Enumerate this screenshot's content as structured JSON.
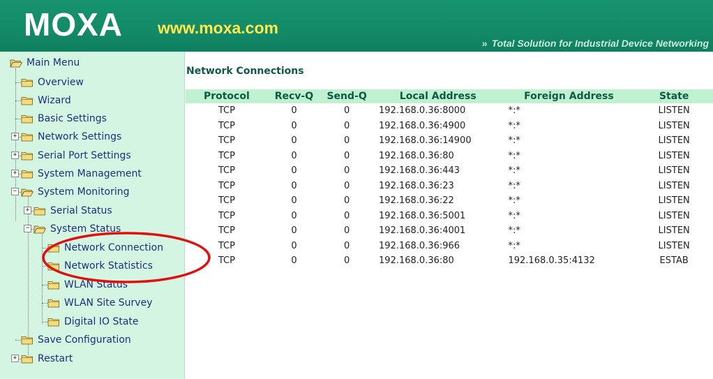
{
  "header": {
    "logo": "MOXA",
    "website": "www.moxa.com",
    "tagline": "Total Solution for Industrial Device Networking",
    "tagline_arrow": "»"
  },
  "sidebar": {
    "items": [
      {
        "label": "Main Menu",
        "expanded": true
      },
      {
        "label": "Overview"
      },
      {
        "label": "Wizard"
      },
      {
        "label": "Basic Settings"
      },
      {
        "label": "Network Settings",
        "expander": "+"
      },
      {
        "label": "Serial Port Settings",
        "expander": "+"
      },
      {
        "label": "System Management",
        "expander": "+"
      },
      {
        "label": "System Monitoring",
        "expander": "-",
        "expanded": true
      },
      {
        "label": "Serial Status",
        "expander": "+"
      },
      {
        "label": "System Status",
        "expander": "-",
        "expanded": true
      },
      {
        "label": "Network Connection",
        "selected": true
      },
      {
        "label": "Network Statistics"
      },
      {
        "label": "WLAN Status"
      },
      {
        "label": "WLAN Site Survey"
      },
      {
        "label": "Digital IO State"
      },
      {
        "label": "Save Configuration"
      },
      {
        "label": "Restart",
        "expander": "+"
      }
    ]
  },
  "main": {
    "title": "Network Connections",
    "columns": [
      "Protocol",
      "Recv-Q",
      "Send-Q",
      "Local Address",
      "Foreign Address",
      "State"
    ],
    "rows": [
      [
        "TCP",
        "0",
        "0",
        "192.168.0.36:8000",
        "*:*",
        "LISTEN"
      ],
      [
        "TCP",
        "0",
        "0",
        "192.168.0.36:4900",
        "*:*",
        "LISTEN"
      ],
      [
        "TCP",
        "0",
        "0",
        "192.168.0.36:14900",
        "*:*",
        "LISTEN"
      ],
      [
        "TCP",
        "0",
        "0",
        "192.168.0.36:80",
        "*:*",
        "LISTEN"
      ],
      [
        "TCP",
        "0",
        "0",
        "192.168.0.36:443",
        "*:*",
        "LISTEN"
      ],
      [
        "TCP",
        "0",
        "0",
        "192.168.0.36:23",
        "*:*",
        "LISTEN"
      ],
      [
        "TCP",
        "0",
        "0",
        "192.168.0.36:22",
        "*:*",
        "LISTEN"
      ],
      [
        "TCP",
        "0",
        "0",
        "192.168.0.36:5001",
        "*:*",
        "LISTEN"
      ],
      [
        "TCP",
        "0",
        "0",
        "192.168.0.36:4001",
        "*:*",
        "LISTEN"
      ],
      [
        "TCP",
        "0",
        "0",
        "192.168.0.36:966",
        "*:*",
        "LISTEN"
      ],
      [
        "TCP",
        "0",
        "0",
        "192.168.0.36:80",
        "192.168.0.35:4132",
        "ESTAB"
      ]
    ]
  },
  "colors": {
    "header_green": "#138a68",
    "sidebar_bg": "#d5f5e3",
    "table_header_bg": "#bff0cf",
    "annotation_red": "#e01010",
    "link_blue": "#1d2f7a"
  },
  "icons": {
    "folder": "folder-icon",
    "open_folder": "folder-open-icon",
    "expander": "expander-icon"
  }
}
